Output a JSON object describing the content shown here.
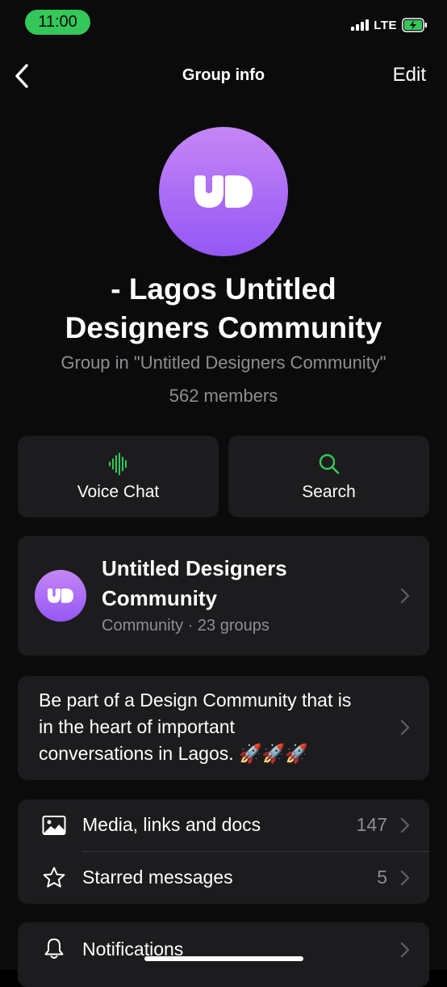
{
  "status_bar": {
    "time": "11:00",
    "network": "LTE",
    "time_pill_color": "#34c759"
  },
  "nav": {
    "title": "Group info",
    "edit_label": "Edit",
    "back_icon": "chevron-left-icon"
  },
  "group": {
    "title_line1": "- Lagos Untitled",
    "title_line2": "Designers Community",
    "subtitle": "Group in \"Untitled Designers Community\"",
    "members": "562 members",
    "avatar_gradient": [
      "#c586f5",
      "#9457f5"
    ],
    "avatar_icon": "ud-logo-icon"
  },
  "actions": [
    {
      "label": "Voice Chat",
      "icon": "voice-wave-icon"
    },
    {
      "label": "Search",
      "icon": "search-icon"
    }
  ],
  "accent_color": "#34c759",
  "community": {
    "name_line1": "Untitled Designers",
    "name_line2": "Community",
    "meta": "Community · 23 groups"
  },
  "description": {
    "line1": "Be part of a Design Community that is",
    "line2": "in the heart of important",
    "line3": "conversations in Lagos. 🚀🚀🚀"
  },
  "list": [
    {
      "label": "Media, links and docs",
      "count": "147",
      "icon": "image-icon"
    },
    {
      "label": "Starred messages",
      "count": "5",
      "icon": "star-icon"
    }
  ],
  "notifications": {
    "label": "Notifications",
    "icon": "bell-icon"
  }
}
